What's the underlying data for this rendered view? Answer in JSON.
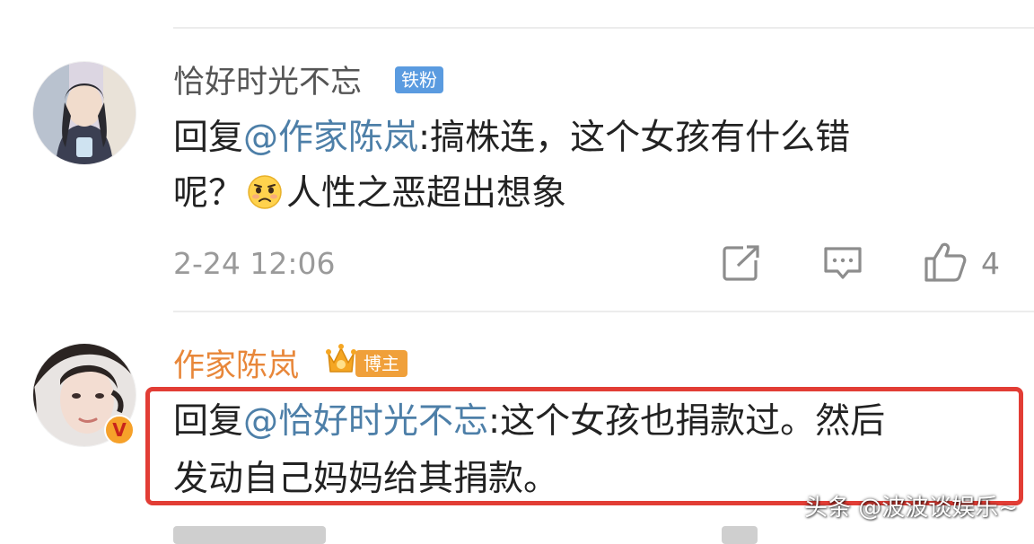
{
  "comments": [
    {
      "username": "恰好时光不忘",
      "badge": "铁粉",
      "reply_prefix": "回复",
      "mention": "@作家陈岚",
      "line1_rest": ":搞株连，这个女孩有什么错",
      "line2_before_emoji": "呢？",
      "emoji": "sad-face-emoji",
      "line2_after_emoji": "人性之恶超出想象",
      "timestamp": "2-24 12:06",
      "like_count": "4"
    },
    {
      "username": "作家陈岚",
      "badge": "博主",
      "verified_mark": "V",
      "reply_prefix": "回复",
      "mention": "@恰好时光不忘",
      "line1_rest": ":这个女孩也捐款过。然后",
      "line2": "发动自己妈妈给其捐款。"
    }
  ],
  "watermark": "头条 @波波谈娱乐~",
  "colors": {
    "username_gray": "#555555",
    "username_orange": "#e8873a",
    "mention_blue": "#4d7fa8",
    "highlight_red": "#e23d35",
    "fan_badge_blue": "#5a9be0"
  }
}
